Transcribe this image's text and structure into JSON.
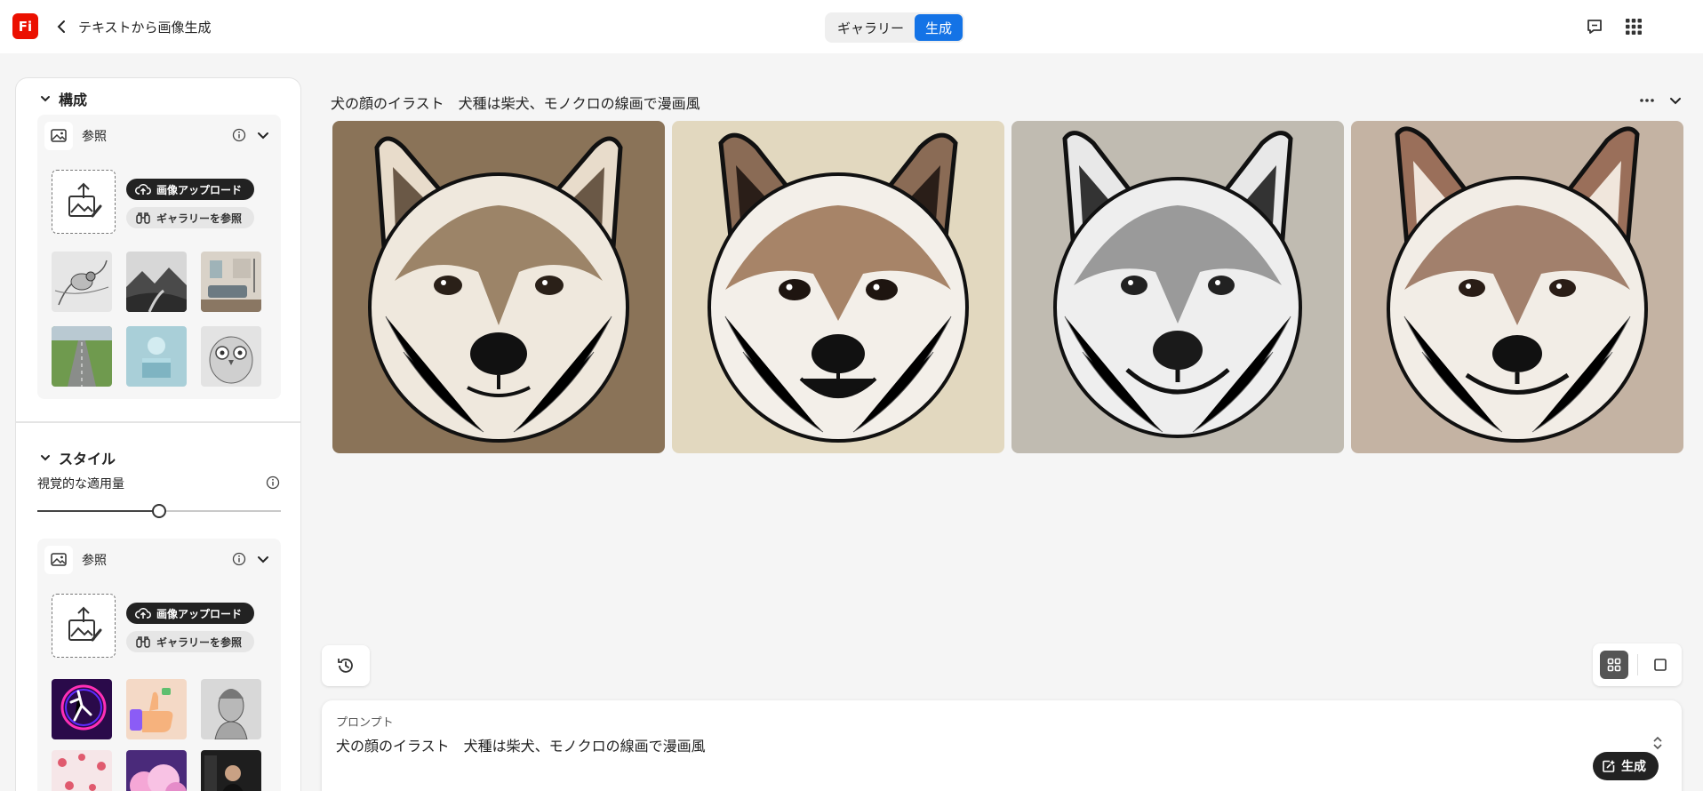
{
  "header": {
    "logo": "Fi",
    "title": "テキストから画像生成",
    "tabs": [
      {
        "label": "ギャラリー"
      },
      {
        "label": "生成"
      }
    ],
    "icons": [
      "back-icon",
      "chat-icon",
      "apps-grid-icon"
    ]
  },
  "panel": {
    "composition": {
      "title": "構成",
      "reference": {
        "title": "参照",
        "upload_label": "画像アップロード",
        "gallery_label": "ギャラリーを参照"
      }
    },
    "style": {
      "title": "スタイル",
      "strength_label": "視覚的な適用量",
      "strength_value": 0.5,
      "reference": {
        "title": "参照",
        "upload_label": "画像アップロード",
        "gallery_label": "ギャラリーを参照"
      }
    }
  },
  "main": {
    "prompt_title": "犬の顔のイラスト　犬種は柴犬、モノクロの線画で漫画風",
    "result_count": 4
  },
  "prompt": {
    "label": "プロンプト",
    "value": "犬の顔のイラスト　犬種は柴犬、モノクロの線画で漫画風",
    "generate_label": "生成"
  },
  "colors": {
    "accent": "#1473e6",
    "logo": "#eb1000",
    "dark_button": "#222222"
  }
}
